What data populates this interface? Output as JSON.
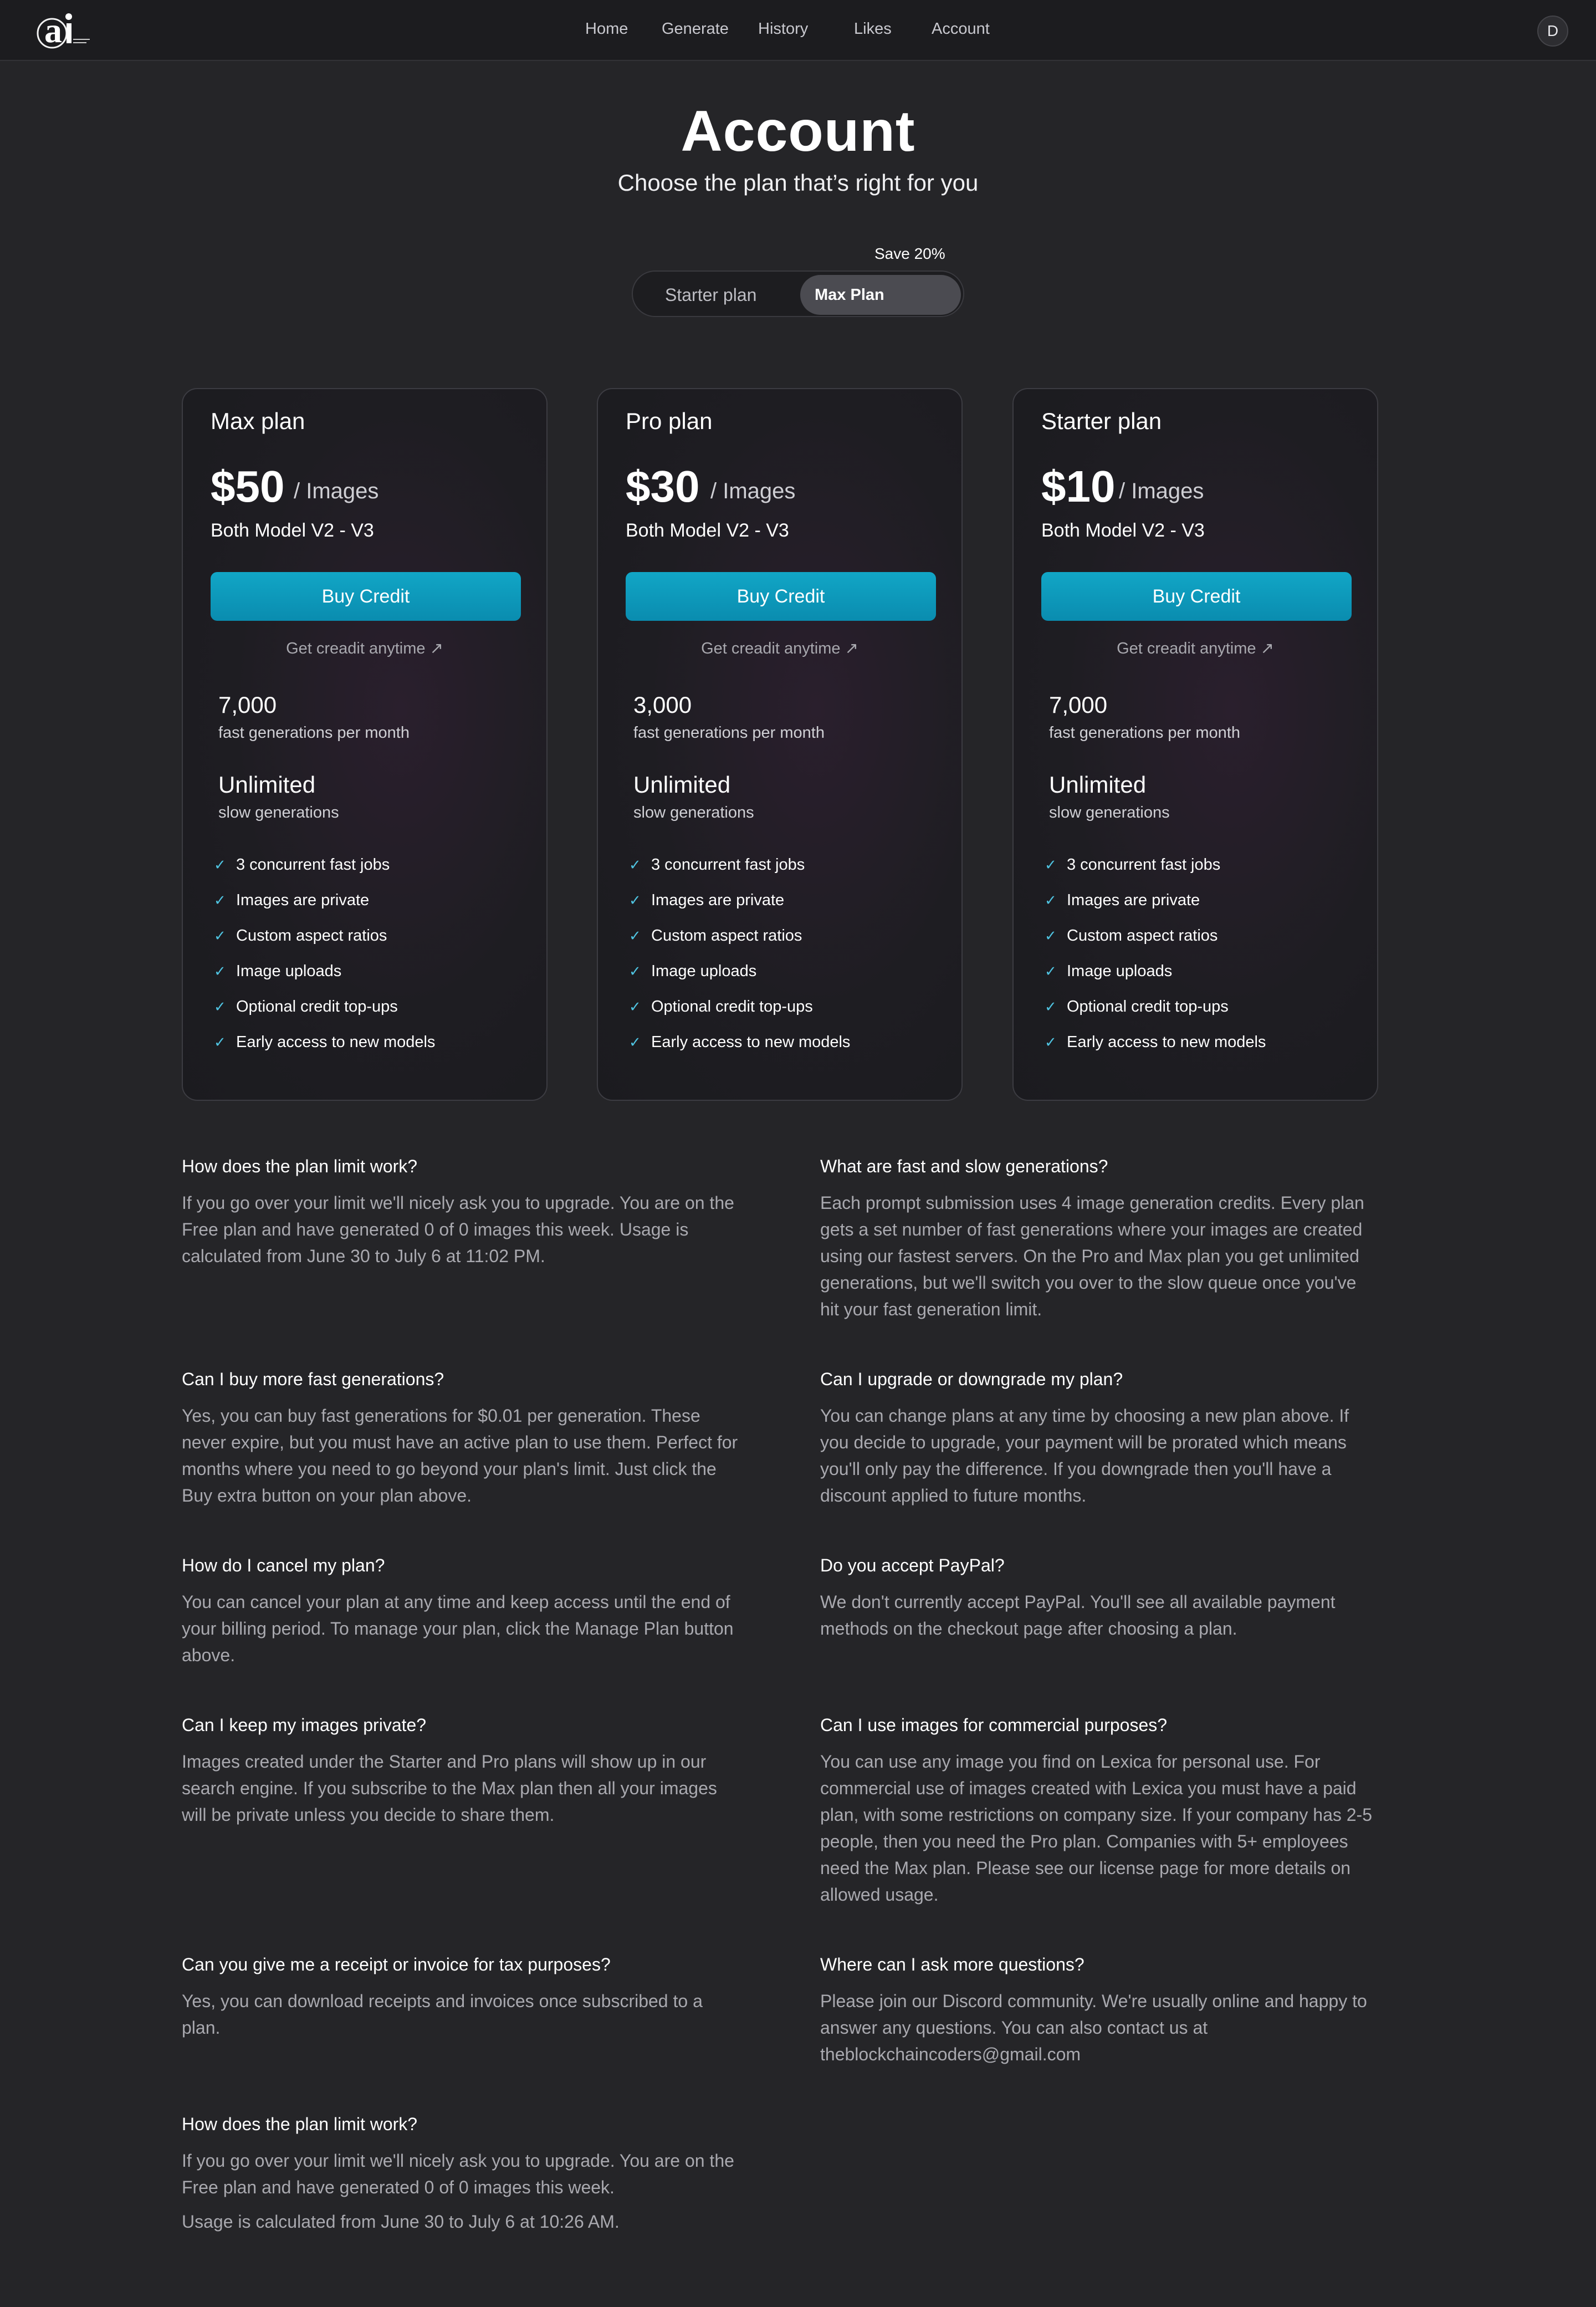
{
  "nav": {
    "links": [
      "Home",
      "Generate",
      "History",
      "Likes",
      "Account"
    ],
    "avatar_initial": "D"
  },
  "header": {
    "title": "Account",
    "subtitle": "Choose the plan that’s right for you",
    "save_badge": "Save 20%",
    "toggle": {
      "options": [
        "Starter plan",
        "Max Plan"
      ],
      "selected": "Max Plan"
    }
  },
  "plans": [
    {
      "name": "Max plan",
      "price": "$50",
      "unit": "/ Images",
      "model": "Both Model V2 - V3",
      "cta": "Buy Credit",
      "link": "Get creadit anytime",
      "fast_count": "7,000",
      "fast_label": "fast generations per month",
      "slow_count": "Unlimited",
      "slow_label": "slow generations",
      "features": [
        "3 concurrent fast jobs",
        "Images are private",
        "Custom aspect ratios",
        "Image uploads",
        "Optional credit top-ups",
        "Early access to new models"
      ]
    },
    {
      "name": "Pro plan",
      "price": "$30",
      "unit": "/ Images",
      "model": "Both Model V2 - V3",
      "cta": "Buy Credit",
      "link": "Get creadit anytime",
      "fast_count": "3,000",
      "fast_label": "fast generations per month",
      "slow_count": "Unlimited",
      "slow_label": "slow generations",
      "features": [
        "3 concurrent fast jobs",
        "Images are private",
        "Custom aspect ratios",
        "Image uploads",
        "Optional credit top-ups",
        "Early access to new models"
      ]
    },
    {
      "name": "Starter plan",
      "price": "$10",
      "unit": "/ Images",
      "model": "Both Model V2 - V3",
      "cta": "Buy Credit",
      "link": "Get creadit anytime",
      "fast_count": "7,000",
      "fast_label": "fast generations per month",
      "slow_count": "Unlimited",
      "slow_label": "slow generations",
      "features": [
        "3 concurrent fast jobs",
        "Images are private",
        "Custom aspect ratios",
        "Image uploads",
        "Optional credit top-ups",
        "Early access to new models"
      ]
    }
  ],
  "faq": [
    {
      "q": "How does the plan limit work?",
      "a": [
        "If you go over your limit we'll nicely ask you to upgrade. You are on the",
        "Free plan and have generated 0 of 0 images this week. Usage is",
        "calculated from June 30 to July 6 at 11:02 PM."
      ]
    },
    {
      "q": "What are fast and slow generations?",
      "a": [
        "Each prompt submission uses 4 image generation credits. Every plan",
        "gets a set number of fast generations where your images are created",
        "using our fastest servers. On the Pro and Max plan you get unlimited",
        "generations, but we'll switch you over to the slow queue once you've",
        "hit your fast generation limit."
      ]
    },
    {
      "q": "Can I buy more fast generations?",
      "a": [
        "Yes, you can buy fast generations for $0.01 per generation. These",
        "never expire, but you must have an active plan to use them. Perfect for",
        "months where you need to go beyond your plan's limit. Just click the",
        "Buy extra button on your plan above."
      ]
    },
    {
      "q": "Can I upgrade or downgrade my plan?",
      "a": [
        "You can change plans at any time by choosing a new plan above. If",
        "you decide to upgrade, your payment will be prorated which means",
        "you'll only pay the difference. If you downgrade then you'll have a",
        "discount applied to future months."
      ]
    },
    {
      "q": "How do I cancel my plan?",
      "a": [
        "You can cancel your plan at any time and keep access until the end of",
        "your billing period. To manage your plan, click the Manage Plan button",
        "above."
      ]
    },
    {
      "q": "Do you accept PayPal?",
      "a": [
        "We don't currently accept PayPal. You'll see all available payment",
        "methods on the checkout page after choosing a plan."
      ]
    },
    {
      "q": "Can I keep my images private?",
      "a": [
        "Images created under the Starter and Pro plans will show up in our",
        "search engine. If you subscribe to the Max plan then all your images",
        "will be private unless you decide to share them."
      ]
    },
    {
      "q": "Can I use images for commercial purposes?",
      "a": [
        "You can use any image you find on Lexica for personal use. For",
        "commercial use of images created with Lexica you must have a paid",
        "plan, with some restrictions on company size. If your company has 2-5",
        "people, then you need the Pro plan. Companies with 5+ employees",
        "need the Max plan. Please see our license page for more details on",
        "allowed usage."
      ]
    },
    {
      "q": "Can you give me a receipt or invoice for tax purposes?",
      "a": [
        "Yes, you can download receipts and invoices once subscribed to a",
        "plan."
      ]
    },
    {
      "q": "Where can I ask more questions?",
      "a": [
        "Please join our Discord community. We're usually online and happy to",
        "answer any questions. You can also contact us at",
        "theblockchaincoders@gmail.com"
      ]
    },
    {
      "q": "How does the plan limit work?",
      "a": [
        "If you go over your limit we'll nicely ask you to upgrade. You are on the",
        "Free plan and have generated 0 of 0 images this week."
      ],
      "a2": "Usage is calculated from June 30 to July 6 at 10:26 AM."
    }
  ]
}
